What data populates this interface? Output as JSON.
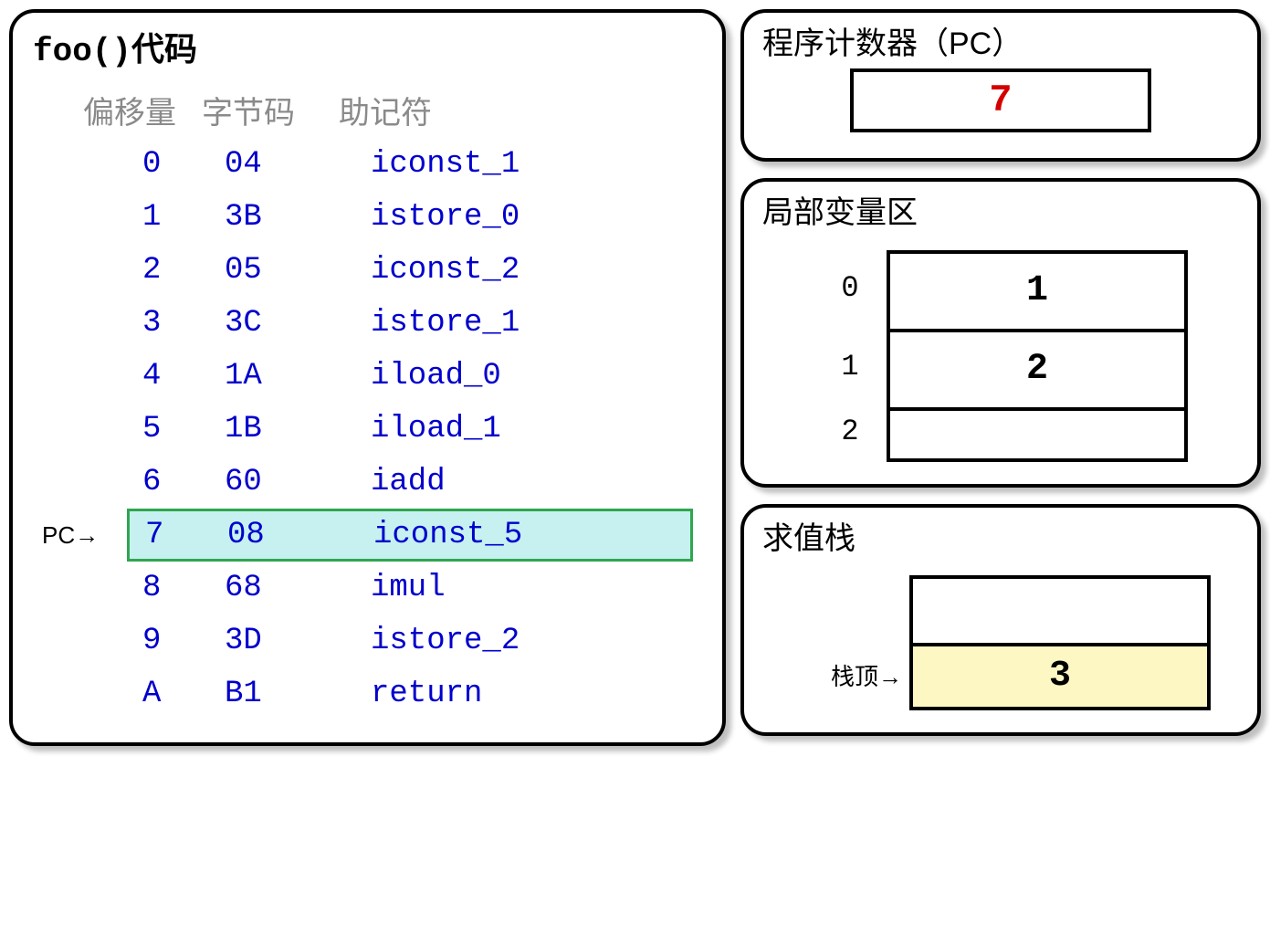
{
  "code_panel": {
    "title_code": "foo()",
    "title_suffix": "代码",
    "headers": {
      "offset": "偏移量",
      "bytecode": "字节码",
      "mnemonic": "助记符"
    },
    "pc_pointer_label": "PC→",
    "highlight_offset": "7",
    "rows": [
      {
        "offset": "0",
        "bytecode": "04",
        "mnemonic": "iconst_1"
      },
      {
        "offset": "1",
        "bytecode": "3B",
        "mnemonic": "istore_0"
      },
      {
        "offset": "2",
        "bytecode": "05",
        "mnemonic": "iconst_2"
      },
      {
        "offset": "3",
        "bytecode": "3C",
        "mnemonic": "istore_1"
      },
      {
        "offset": "4",
        "bytecode": "1A",
        "mnemonic": "iload_0"
      },
      {
        "offset": "5",
        "bytecode": "1B",
        "mnemonic": "iload_1"
      },
      {
        "offset": "6",
        "bytecode": "60",
        "mnemonic": "iadd"
      },
      {
        "offset": "7",
        "bytecode": "08",
        "mnemonic": "iconst_5"
      },
      {
        "offset": "8",
        "bytecode": "68",
        "mnemonic": "imul"
      },
      {
        "offset": "9",
        "bytecode": "3D",
        "mnemonic": "istore_2"
      },
      {
        "offset": "A",
        "bytecode": "B1",
        "mnemonic": "return"
      }
    ]
  },
  "pc_panel": {
    "label": "程序计数器（PC）",
    "value": "7"
  },
  "locals_panel": {
    "label": "局部变量区",
    "slots": [
      {
        "index": "0",
        "value": "1"
      },
      {
        "index": "1",
        "value": "2"
      },
      {
        "index": "2",
        "value": ""
      }
    ]
  },
  "stack_panel": {
    "label": "求值栈",
    "top_label": "栈顶→",
    "cells": [
      {
        "value": "",
        "is_top": false
      },
      {
        "value": "3",
        "is_top": true
      }
    ]
  }
}
